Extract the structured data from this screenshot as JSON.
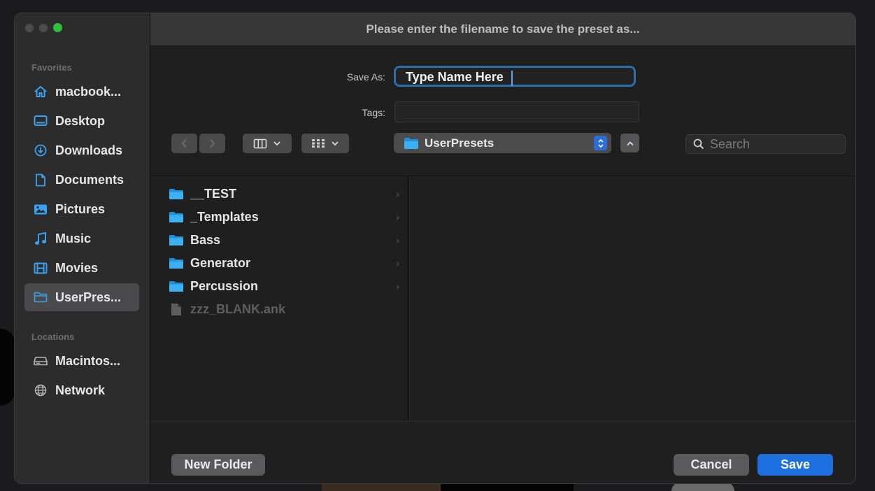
{
  "dialog": {
    "title": "Please enter the filename to save the preset as...",
    "save_as_label": "Save As:",
    "save_as_value": "Type Name Here",
    "tags_label": "Tags:",
    "tags_value": ""
  },
  "sidebar": {
    "favorites_label": "Favorites",
    "favorites": [
      {
        "label": "macbook...",
        "icon": "home-icon"
      },
      {
        "label": "Desktop",
        "icon": "desktop-icon"
      },
      {
        "label": "Downloads",
        "icon": "download-icon"
      },
      {
        "label": "Documents",
        "icon": "document-icon"
      },
      {
        "label": "Pictures",
        "icon": "pictures-icon"
      },
      {
        "label": "Music",
        "icon": "music-icon"
      },
      {
        "label": "Movies",
        "icon": "movies-icon"
      },
      {
        "label": "UserPres...",
        "icon": "folder-icon",
        "selected": true
      }
    ],
    "locations_label": "Locations",
    "locations": [
      {
        "label": "Macintos...",
        "icon": "disk-icon"
      },
      {
        "label": "Network",
        "icon": "globe-icon"
      }
    ]
  },
  "toolbar": {
    "path_folder": "UserPresets",
    "search_placeholder": "Search"
  },
  "files": [
    {
      "name": "__TEST",
      "type": "folder",
      "has_children": true
    },
    {
      "name": "_Templates",
      "type": "folder",
      "has_children": true
    },
    {
      "name": "Bass",
      "type": "folder",
      "has_children": true
    },
    {
      "name": "Generator",
      "type": "folder",
      "has_children": true
    },
    {
      "name": "Percussion",
      "type": "folder",
      "has_children": true
    },
    {
      "name": "zzz_BLANK.ank",
      "type": "file",
      "disabled": true
    }
  ],
  "buttons": {
    "new_folder": "New Folder",
    "cancel": "Cancel",
    "save": "Save"
  },
  "colors": {
    "accent": "#2a6ed6",
    "folder": "#35a8e8",
    "focus_ring": "#2a6fa8",
    "close_green": "#2ac33f"
  }
}
